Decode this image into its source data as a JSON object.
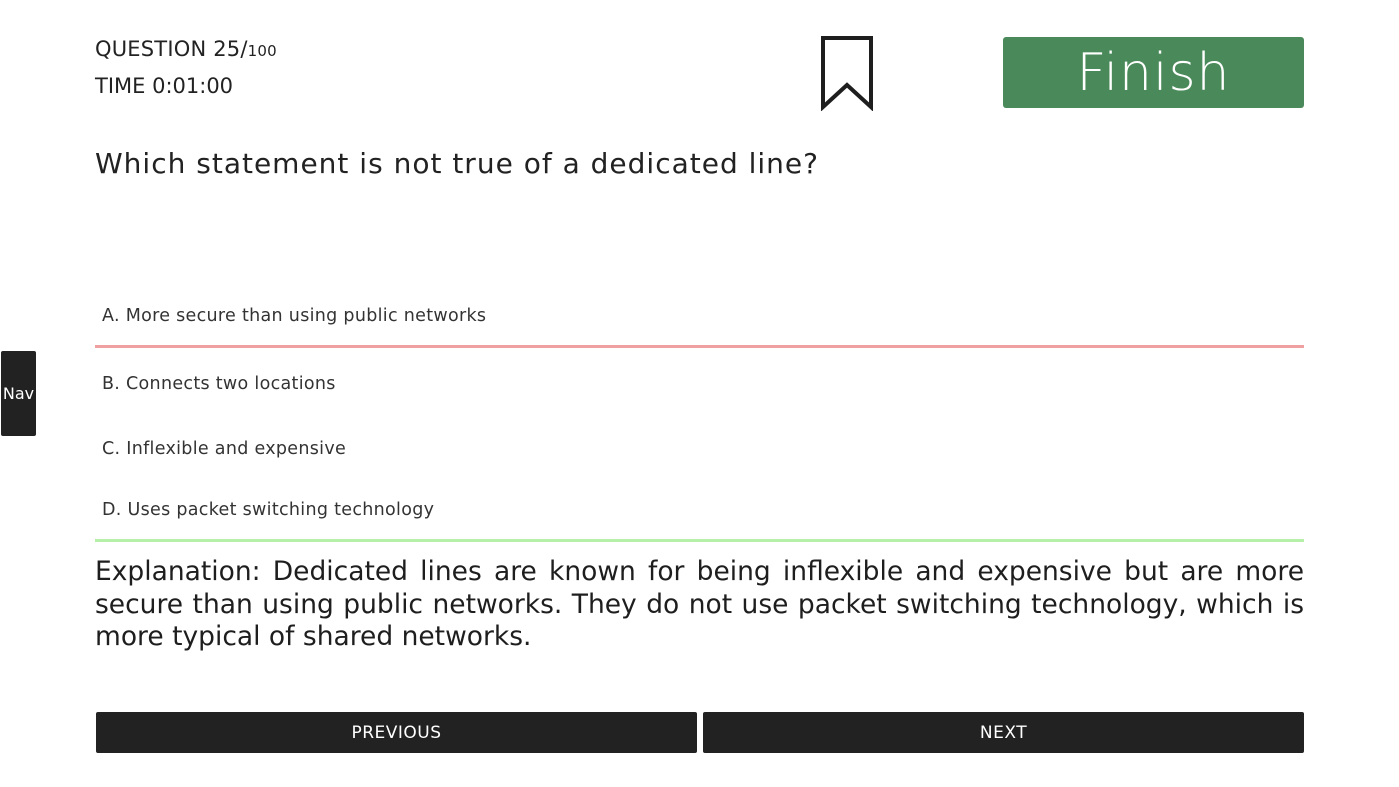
{
  "header": {
    "question_label": "QUESTION 25/",
    "question_total": "100",
    "time_label": "TIME 0:01:00",
    "bookmark_icon": "bookmark-icon",
    "finish_label": "Finish",
    "finish_color": "#4a8a5a"
  },
  "question": {
    "text": "Which statement is not true of a dedicated line?"
  },
  "options": [
    {
      "label": "A. More secure than using public networks",
      "status": "wrong",
      "status_color": "#efa0a0"
    },
    {
      "label": "B. Connects two locations"
    },
    {
      "label": "C. Inflexible and expensive"
    },
    {
      "label": "D. Uses packet switching technology",
      "status": "correct",
      "status_color": "#b6f0a8"
    }
  ],
  "explanation": {
    "text": "Explanation: Dedicated lines are known for being inflexible and expensive but are more secure than using public networks. They do not use packet switching technology, which is more typical of shared networks."
  },
  "sidebar": {
    "nav_label": "Nav"
  },
  "footer": {
    "previous_label": "PREVIOUS",
    "next_label": "NEXT"
  }
}
